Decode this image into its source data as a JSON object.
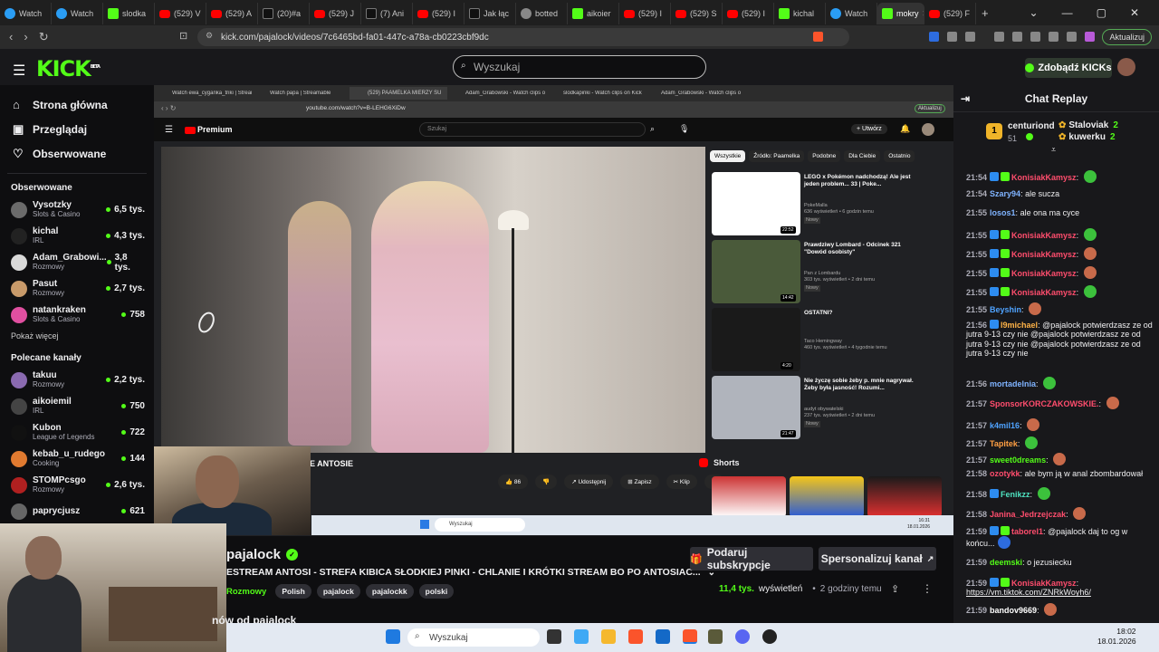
{
  "browser": {
    "tabs": [
      {
        "label": "Watch",
        "icon": "st"
      },
      {
        "label": "Watch",
        "icon": "st"
      },
      {
        "label": "slodka",
        "icon": "k"
      },
      {
        "label": "(529) V",
        "icon": "yt"
      },
      {
        "label": "(529) A",
        "icon": "yt"
      },
      {
        "label": "(20)#a",
        "icon": "tt"
      },
      {
        "label": "(529) J",
        "icon": "yt"
      },
      {
        "label": "(7) Ani",
        "icon": "tt"
      },
      {
        "label": "(529) I",
        "icon": "yt"
      },
      {
        "label": "Jak łąc",
        "icon": "tt"
      },
      {
        "label": "botted",
        "icon": "bt"
      },
      {
        "label": "aikoier",
        "icon": "k"
      },
      {
        "label": "(529) I",
        "icon": "yt"
      },
      {
        "label": "(529) S",
        "icon": "yt"
      },
      {
        "label": "(529) I",
        "icon": "yt"
      },
      {
        "label": "kichal",
        "icon": "k"
      },
      {
        "label": "Watch",
        "icon": "st"
      },
      {
        "label": "mokry",
        "icon": "k"
      },
      {
        "label": "(529) F",
        "icon": "yt"
      }
    ],
    "url": "kick.com/pajalock/videos/7c6465bd-fa01-447c-a78a-cb0223cbf9dc",
    "update_label": "Aktualizuj"
  },
  "header": {
    "logo": "KICK",
    "logo_beta": "BETA",
    "search_placeholder": "Wyszukaj",
    "kicks_button": "Zdobądź KICKs"
  },
  "sidebar": {
    "nav": [
      {
        "label": "Strona główna",
        "icon": "home-icon",
        "glyph": "⌂"
      },
      {
        "label": "Przeglądaj",
        "icon": "browse-icon",
        "glyph": "▣"
      },
      {
        "label": "Obserwowane",
        "icon": "heart-icon",
        "glyph": "♡"
      }
    ],
    "followed_title": "Obserwowane",
    "followed": [
      {
        "name": "Vysotzky",
        "category": "Slots & Casino",
        "viewers": "6,5 tys.",
        "color": "#6b6b6b"
      },
      {
        "name": "kichal",
        "category": "IRL",
        "viewers": "4,3 tys.",
        "color": "#222222"
      },
      {
        "name": "Adam_Grabowi...",
        "category": "Rozmowy",
        "viewers": "3,8 tys.",
        "color": "#d9d9d9"
      },
      {
        "name": "Pasut",
        "category": "Rozmowy",
        "viewers": "2,7 tys.",
        "color": "#c89a6a"
      },
      {
        "name": "natankraken",
        "category": "Slots & Casino",
        "viewers": "758",
        "color": "#e04fa0"
      }
    ],
    "show_more": "Pokaż więcej",
    "recommended_title": "Polecane kanały",
    "recommended": [
      {
        "name": "takuu",
        "category": "Rozmowy",
        "viewers": "2,2 tys.",
        "color": "#8a6ab0"
      },
      {
        "name": "aikoiemil",
        "category": "IRL",
        "viewers": "750",
        "color": "#444444"
      },
      {
        "name": "Kubon",
        "category": "League of Legends",
        "viewers": "722",
        "color": "#111111"
      },
      {
        "name": "kebab_u_rudego",
        "category": "Cooking",
        "viewers": "144",
        "color": "#e07a30"
      },
      {
        "name": "STOMPcsgo",
        "category": "Rozmowy",
        "viewers": "2,6 tys.",
        "color": "#b02020"
      },
      {
        "name": "paprycjusz",
        "category": "",
        "viewers": "621",
        "color": "#666666"
      }
    ]
  },
  "stream_video": {
    "inner_tabs": [
      "Watch ewa_cyganka_triki | Streamab",
      "Watch papa | Streamable",
      "(529) PAAMELKA MIERZY SU",
      "Adam_Grabowski - Watch clips on",
      "slodkapinki - Watch clips on Kick",
      "Adam_Grabowski - Watch clips on"
    ],
    "inner_url": "youtube.com/watch?v=B-LEHG6XiDw",
    "inner_update": "Aktualizuj",
    "yt_logo": "Premium",
    "yt_search": "Szukaj",
    "yt_create": "+ Utwórz",
    "yt_title_partial": "E ANTOSIE",
    "yt_actions": [
      "👍 86",
      "👎",
      "↗ Udostępnij",
      "⊞ Zapisz",
      "✂ Klip",
      "⋯"
    ],
    "chips": [
      "Wszystkie",
      "Źródło: Paamelka",
      "Podobne",
      "Dla Ciebie",
      "Ostatnio"
    ],
    "recs": [
      {
        "title": "LEGO x Pokémon nadchodzą! Ale jest jeden problem... 33 | Poke...",
        "channel": "PokeMalla",
        "meta": "636 wyświetleń • 6 godzin temu",
        "badge": "Nowy",
        "duration": "22:52",
        "color": "#ffffff"
      },
      {
        "title": "Prawdziwy Lombard - Odcinek 321 \"Dowód osobisty\"",
        "channel": "Pan z Lombardu",
        "meta": "303 tys. wyświetleń • 2 dni temu",
        "badge": "Nowy",
        "duration": "14:42",
        "color": "#4a5a3a"
      },
      {
        "title": "OSTATNI?",
        "channel": "Taco Hemingway",
        "meta": "460 tys. wyświetleń • 4 tygodnie temu",
        "badge": "",
        "duration": "4:20",
        "color": "#1a1a1a"
      },
      {
        "title": "Nie życzę sobie żeby p. mnie nagrywał. Żeby była jasność! Rozumi...",
        "channel": "audyt obywatelski",
        "meta": "237 tys. wyświetleń • 2 dni temu",
        "badge": "Nowy",
        "duration": "21:47",
        "color": "#b0b4bc"
      }
    ],
    "shorts_label": "Shorts",
    "inner_taskbar_search": "Wyszukaj",
    "inner_clock_time": "16:31",
    "inner_clock_date": "18.01.2026"
  },
  "video_info": {
    "channel": "pajalock",
    "title": "ESTREAM ANTOSI - STREFA KIBICA SŁODKIEJ PINKI - CHLANIE I KRÓTKI STREAM BO PO ANTOSIAC...",
    "category": "Rozmowy",
    "tags": [
      "Polish",
      "pajalock",
      "pajalockk",
      "polski"
    ],
    "views": "11,4 tys.",
    "views_label": "wyświetleń",
    "ago": "2 godziny temu",
    "subscribe_button": "Podaruj subskrypcje",
    "customize_button": "Spersonalizuj kanał",
    "clips_heading": "nów od pajalock"
  },
  "chat": {
    "title": "Chat Replay",
    "gift_leader": {
      "rank": "1",
      "name": "centuriond",
      "count": "51"
    },
    "gift_others": [
      {
        "name": "Staloviak",
        "count": "2"
      },
      {
        "name": "kuwerku",
        "count": "2"
      }
    ],
    "messages": [
      {
        "time": "21:54",
        "user": "KonisiakKamysz",
        "color": "#ff4d6d",
        "text": "",
        "badges": 2,
        "emote": true
      },
      {
        "time": "21:54",
        "user": "Szary94",
        "color": "#7fb3ff",
        "text": "ale sucza",
        "badges": 0,
        "emote": false
      },
      {
        "time": "21:55",
        "user": "losos1",
        "color": "#7fb3ff",
        "text": "ale ona ma cyce",
        "badges": 0,
        "emote": false
      },
      {
        "time": "21:55",
        "user": "KonisiakKamysz",
        "color": "#ff4d6d",
        "text": "",
        "badges": 2,
        "emote": true
      },
      {
        "time": "21:55",
        "user": "KonisiakKamysz",
        "color": "#ff4d6d",
        "text": "",
        "badges": 2,
        "emote": true
      },
      {
        "time": "21:55",
        "user": "KonisiakKamysz",
        "color": "#ff4d6d",
        "text": "",
        "badges": 2,
        "emote": true
      },
      {
        "time": "21:55",
        "user": "KonisiakKamysz",
        "color": "#ff4d6d",
        "text": "",
        "badges": 2,
        "emote": true
      },
      {
        "time": "21:55",
        "user": "Beyshin",
        "color": "#4fa3ff",
        "text": "",
        "badges": 0,
        "emote": true
      },
      {
        "time": "21:56",
        "user": "l9michael",
        "color": "#ffb347",
        "text": "@pajalock potwierdzasz ze od jutra 9-13 czy nie @pajalock potwierdzasz ze od jutra 9-13 czy nie @pajalock potwierdzasz ze od jutra 9-13 czy nie",
        "badges": 1,
        "emote": false
      },
      {
        "time": "21:56",
        "user": "mortadelnia",
        "color": "#7fb3ff",
        "text": "",
        "badges": 0,
        "emote": true
      },
      {
        "time": "21:57",
        "user": "SponsorKORCZAKOWSKIE.",
        "color": "#ff4d6d",
        "text": "",
        "badges": 0,
        "emote": true
      },
      {
        "time": "21:57",
        "user": "k4mil16",
        "color": "#4fa3ff",
        "text": "",
        "badges": 0,
        "emote": true
      },
      {
        "time": "21:57",
        "user": "Tapitek",
        "color": "#ff9f43",
        "text": "",
        "badges": 0,
        "emote": true
      },
      {
        "time": "21:57",
        "user": "sweet0dreams",
        "color": "#53fc18",
        "text": "",
        "badges": 0,
        "emote": true
      },
      {
        "time": "21:58",
        "user": "ozotykk",
        "color": "#ff4d6d",
        "text": "ale bym ją w anal zbombardował",
        "badges": 0,
        "emote": false
      },
      {
        "time": "21:58",
        "user": "Fenikzz",
        "color": "#4fe3c1",
        "text": "",
        "badges": 1,
        "emote": true
      },
      {
        "time": "21:58",
        "user": "Janina_Jedrzejczak",
        "color": "#ff4d6d",
        "text": "",
        "badges": 0,
        "emote": true
      },
      {
        "time": "21:59",
        "user": "taborel1",
        "color": "#ff4d6d",
        "text": "@pajalock daj to og w końcu...",
        "badges": 2,
        "emote": true
      },
      {
        "time": "21:59",
        "user": "deemski",
        "color": "#53fc18",
        "text": "o jezusiecku",
        "badges": 0,
        "emote": false
      },
      {
        "time": "21:59",
        "user": "KonisiakKamysz",
        "color": "#ff4d6d",
        "text": "https://vm.tiktok.com/ZNRkWoyh6/",
        "badges": 2,
        "emote": false
      },
      {
        "time": "21:59",
        "user": "bandov9669",
        "color": "#ffffff",
        "text": "",
        "badges": 0,
        "emote": true
      }
    ]
  },
  "taskbar": {
    "search": "Wyszukaj",
    "time": "18:02",
    "date": "18.01.2026"
  }
}
